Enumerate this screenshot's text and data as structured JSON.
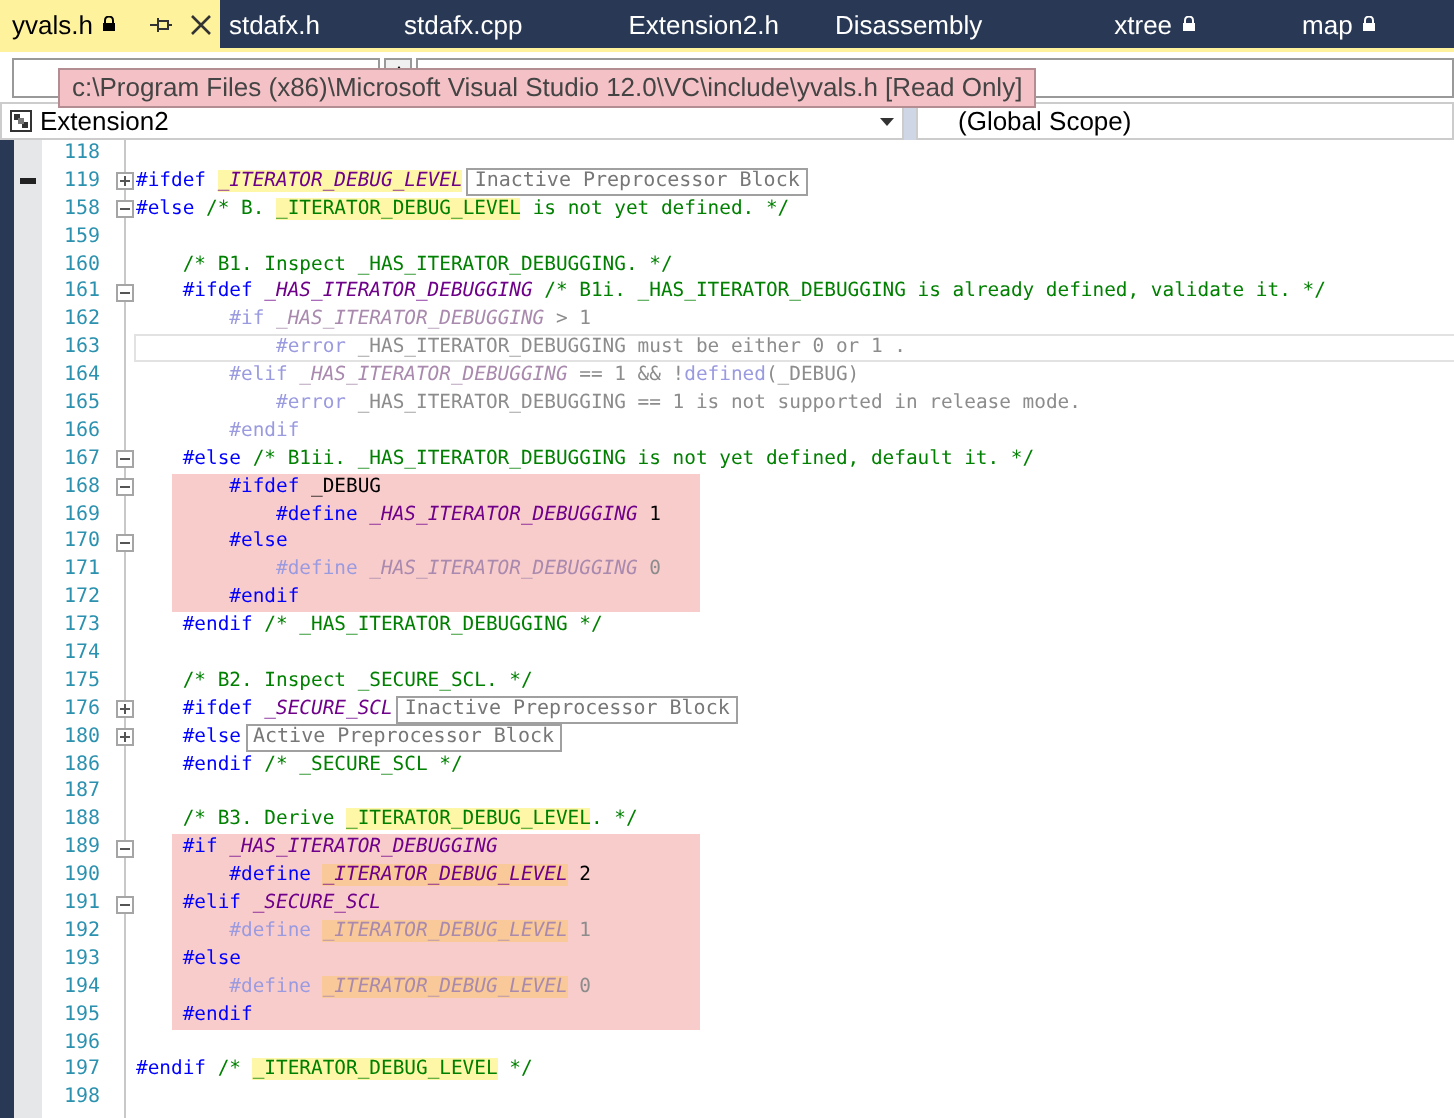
{
  "tabs": [
    {
      "label": "yvals.h",
      "selected": true,
      "locked": true,
      "pinnable": true
    },
    {
      "label": "stdafx.h",
      "selected": false,
      "locked": false,
      "pinnable": false
    },
    {
      "label": "stdafx.cpp",
      "selected": false,
      "locked": false,
      "pinnable": false
    },
    {
      "label": "Extension2.h",
      "selected": false,
      "locked": false,
      "pinnable": false
    },
    {
      "label": "Disassembly",
      "selected": false,
      "locked": false,
      "pinnable": false
    },
    {
      "label": "xtree",
      "selected": false,
      "locked": true,
      "pinnable": false
    },
    {
      "label": "map",
      "selected": false,
      "locked": true,
      "pinnable": false
    }
  ],
  "tooltip": "c:\\Program Files (x86)\\Microsoft Visual Studio 12.0\\VC\\include\\yvals.h [Read Only]",
  "navigation": {
    "project": "Extension2",
    "scope": "(Global Scope)"
  },
  "lines": [
    {
      "number": "118",
      "kind": "plain",
      "shaded": false,
      "current": false,
      "marked": false
    },
    {
      "number": "119",
      "kind": "collapsed-block",
      "shaded": false,
      "current": false,
      "marked": true,
      "tokens": [
        {
          "text": "#ifdef ",
          "kind": "directive",
          "highlight": false
        },
        {
          "text": "_ITERATOR_DEBUG_LEVEL",
          "kind": "macro",
          "highlight": true
        }
      ],
      "collapsed_label": "Inactive Preprocessor Block"
    },
    {
      "number": "158",
      "kind": "expanded-block",
      "shaded": false,
      "current": false,
      "marked": false,
      "tokens": [
        {
          "text": "#else ",
          "kind": "directive",
          "highlight": false
        },
        {
          "text": "/* B. ",
          "kind": "comment",
          "highlight": false
        },
        {
          "text": "_ITERATOR_DEBUG_LEVEL",
          "kind": "comment",
          "highlight": true
        },
        {
          "text": " is not yet defined. */",
          "kind": "comment",
          "highlight": false
        }
      ]
    },
    {
      "number": "159",
      "kind": "plain",
      "shaded": false,
      "current": false,
      "marked": false
    },
    {
      "number": "160",
      "kind": "plain",
      "shaded": false,
      "current": false,
      "marked": false,
      "tokens": [
        {
          "text": "    /* B1. Inspect _HAS_ITERATOR_DEBUGGING. */",
          "kind": "comment",
          "highlight": false
        }
      ]
    },
    {
      "number": "161",
      "kind": "expanded-block",
      "shaded": false,
      "current": false,
      "marked": false,
      "tokens": [
        {
          "text": "    #ifdef ",
          "kind": "directive",
          "highlight": false
        },
        {
          "text": "_HAS_ITERATOR_DEBUGGING",
          "kind": "macro",
          "highlight": false
        },
        {
          "text": " /* B1i. _HAS_ITERATOR_DEBUGGING is already defined, validate it. */",
          "kind": "comment",
          "highlight": false
        }
      ]
    },
    {
      "number": "162",
      "kind": "plain",
      "shaded": false,
      "current": false,
      "marked": false,
      "tokens": [
        {
          "text": "        #if ",
          "kind": "dim-directive",
          "highlight": false
        },
        {
          "text": "_HAS_ITERATOR_DEBUGGING",
          "kind": "dim-macro",
          "highlight": false
        },
        {
          "text": " > 1",
          "kind": "dim-text",
          "highlight": false
        }
      ]
    },
    {
      "number": "163",
      "kind": "plain",
      "shaded": false,
      "current": true,
      "marked": false,
      "tokens": [
        {
          "text": "            #error ",
          "kind": "dim-directive",
          "highlight": false
        },
        {
          "text": "_HAS_ITERATOR_DEBUGGING must be either 0 or 1 .",
          "kind": "dim-text",
          "highlight": false
        }
      ]
    },
    {
      "number": "164",
      "kind": "plain",
      "shaded": false,
      "current": false,
      "marked": false,
      "tokens": [
        {
          "text": "        #elif ",
          "kind": "dim-directive",
          "highlight": false
        },
        {
          "text": "_HAS_ITERATOR_DEBUGGING",
          "kind": "dim-macro",
          "highlight": false
        },
        {
          "text": " == 1 && !",
          "kind": "dim-text",
          "highlight": false
        },
        {
          "text": "defined",
          "kind": "dim-directive",
          "highlight": false
        },
        {
          "text": "(_DEBUG)",
          "kind": "dim-text",
          "highlight": false
        }
      ]
    },
    {
      "number": "165",
      "kind": "plain",
      "shaded": false,
      "current": false,
      "marked": false,
      "tokens": [
        {
          "text": "            #error ",
          "kind": "dim-directive",
          "highlight": false
        },
        {
          "text": "_HAS_ITERATOR_DEBUGGING == 1 is not supported in release mode.",
          "kind": "dim-text",
          "highlight": false
        }
      ]
    },
    {
      "number": "166",
      "kind": "plain",
      "shaded": false,
      "current": false,
      "marked": false,
      "tokens": [
        {
          "text": "        #endif",
          "kind": "dim-directive",
          "highlight": false
        }
      ]
    },
    {
      "number": "167",
      "kind": "expanded-block",
      "shaded": false,
      "current": false,
      "marked": false,
      "tokens": [
        {
          "text": "    #else ",
          "kind": "directive",
          "highlight": false
        },
        {
          "text": "/* B1ii. _HAS_ITERATOR_DEBUGGING is not yet defined, default it. */",
          "kind": "comment",
          "highlight": false
        }
      ]
    },
    {
      "number": "168",
      "kind": "expanded-block",
      "shaded": true,
      "current": false,
      "marked": false,
      "tokens": [
        {
          "text": "        #ifdef ",
          "kind": "directive",
          "highlight": false
        },
        {
          "text": "_DEBUG",
          "kind": "text",
          "highlight": false
        }
      ]
    },
    {
      "number": "169",
      "kind": "plain",
      "shaded": true,
      "current": false,
      "marked": false,
      "tokens": [
        {
          "text": "            #define ",
          "kind": "directive",
          "highlight": false
        },
        {
          "text": "_HAS_ITERATOR_DEBUGGING",
          "kind": "macro",
          "highlight": false
        },
        {
          "text": " 1",
          "kind": "text",
          "highlight": false
        }
      ]
    },
    {
      "number": "170",
      "kind": "expanded-block",
      "shaded": true,
      "current": false,
      "marked": false,
      "tokens": [
        {
          "text": "        #else",
          "kind": "directive",
          "highlight": false
        }
      ]
    },
    {
      "number": "171",
      "kind": "plain",
      "shaded": true,
      "current": false,
      "marked": false,
      "tokens": [
        {
          "text": "            #define ",
          "kind": "dim-directive",
          "highlight": false
        },
        {
          "text": "_HAS_ITERATOR_DEBUGGING",
          "kind": "dim-macro",
          "highlight": false
        },
        {
          "text": " 0",
          "kind": "dim-text",
          "highlight": false
        }
      ]
    },
    {
      "number": "172",
      "kind": "plain",
      "shaded": true,
      "current": false,
      "marked": false,
      "tokens": [
        {
          "text": "        #endif",
          "kind": "directive",
          "highlight": false
        }
      ]
    },
    {
      "number": "173",
      "kind": "plain",
      "shaded": false,
      "current": false,
      "marked": false,
      "tokens": [
        {
          "text": "    #endif ",
          "kind": "directive",
          "highlight": false
        },
        {
          "text": "/* _HAS_ITERATOR_DEBUGGING */",
          "kind": "comment",
          "highlight": false
        }
      ]
    },
    {
      "number": "174",
      "kind": "plain",
      "shaded": false,
      "current": false,
      "marked": false
    },
    {
      "number": "175",
      "kind": "plain",
      "shaded": false,
      "current": false,
      "marked": false,
      "tokens": [
        {
          "text": "    /* B2. Inspect _SECURE_SCL. */",
          "kind": "comment",
          "highlight": false
        }
      ]
    },
    {
      "number": "176",
      "kind": "collapsed-block",
      "shaded": false,
      "current": false,
      "marked": false,
      "tokens": [
        {
          "text": "    #ifdef ",
          "kind": "directive",
          "highlight": false
        },
        {
          "text": "_SECURE_SCL",
          "kind": "macro",
          "highlight": false
        }
      ],
      "collapsed_label": "Inactive Preprocessor Block"
    },
    {
      "number": "180",
      "kind": "collapsed-block",
      "shaded": false,
      "current": false,
      "marked": false,
      "tokens": [
        {
          "text": "    #else",
          "kind": "directive",
          "highlight": false
        }
      ],
      "collapsed_label": "Active Preprocessor Block"
    },
    {
      "number": "186",
      "kind": "plain",
      "shaded": false,
      "current": false,
      "marked": false,
      "tokens": [
        {
          "text": "    #endif ",
          "kind": "directive",
          "highlight": false
        },
        {
          "text": "/* _SECURE_SCL */",
          "kind": "comment",
          "highlight": false
        }
      ]
    },
    {
      "number": "187",
      "kind": "plain",
      "shaded": false,
      "current": false,
      "marked": false
    },
    {
      "number": "188",
      "kind": "plain",
      "shaded": false,
      "current": false,
      "marked": false,
      "tokens": [
        {
          "text": "    /* B3. Derive ",
          "kind": "comment",
          "highlight": false
        },
        {
          "text": "_ITERATOR_DEBUG_LEVEL",
          "kind": "comment",
          "highlight": true
        },
        {
          "text": ". */",
          "kind": "comment",
          "highlight": false
        }
      ]
    },
    {
      "number": "189",
      "kind": "expanded-block",
      "shaded": true,
      "current": false,
      "marked": false,
      "tokens": [
        {
          "text": "    #if ",
          "kind": "directive",
          "highlight": false
        },
        {
          "text": "_HAS_ITERATOR_DEBUGGING",
          "kind": "macro",
          "highlight": false
        }
      ]
    },
    {
      "number": "190",
      "kind": "plain",
      "shaded": true,
      "current": false,
      "marked": false,
      "tokens": [
        {
          "text": "        #define ",
          "kind": "directive",
          "highlight": false
        },
        {
          "text": "_ITERATOR_DEBUG_LEVEL",
          "kind": "macro",
          "highlight": true
        },
        {
          "text": " 2",
          "kind": "text",
          "highlight": false
        }
      ]
    },
    {
      "number": "191",
      "kind": "expanded-block",
      "shaded": true,
      "current": false,
      "marked": false,
      "tokens": [
        {
          "text": "    #elif ",
          "kind": "directive",
          "highlight": false
        },
        {
          "text": "_SECURE_SCL",
          "kind": "macro",
          "highlight": false
        }
      ]
    },
    {
      "number": "192",
      "kind": "plain",
      "shaded": true,
      "current": false,
      "marked": false,
      "tokens": [
        {
          "text": "        #define ",
          "kind": "dim-directive",
          "highlight": false
        },
        {
          "text": "_ITERATOR_DEBUG_LEVEL",
          "kind": "dim-macro",
          "highlight": true
        },
        {
          "text": " 1",
          "kind": "dim-text",
          "highlight": false
        }
      ]
    },
    {
      "number": "193",
      "kind": "plain",
      "shaded": true,
      "current": false,
      "marked": false,
      "tokens": [
        {
          "text": "    #else",
          "kind": "directive",
          "highlight": false
        }
      ]
    },
    {
      "number": "194",
      "kind": "plain",
      "shaded": true,
      "current": false,
      "marked": false,
      "tokens": [
        {
          "text": "        #define ",
          "kind": "dim-directive",
          "highlight": false
        },
        {
          "text": "_ITERATOR_DEBUG_LEVEL",
          "kind": "dim-macro",
          "highlight": true
        },
        {
          "text": " 0",
          "kind": "dim-text",
          "highlight": false
        }
      ]
    },
    {
      "number": "195",
      "kind": "plain",
      "shaded": true,
      "current": false,
      "marked": false,
      "tokens": [
        {
          "text": "    #endif",
          "kind": "directive",
          "highlight": false
        }
      ]
    },
    {
      "number": "196",
      "kind": "plain",
      "shaded": false,
      "current": false,
      "marked": false
    },
    {
      "number": "197",
      "kind": "plain",
      "shaded": false,
      "current": false,
      "marked": false,
      "tokens": [
        {
          "text": "#endif ",
          "kind": "directive",
          "highlight": false
        },
        {
          "text": "/* ",
          "kind": "comment",
          "highlight": false
        },
        {
          "text": "_ITERATOR_DEBUG_LEVEL",
          "kind": "comment",
          "highlight": true
        },
        {
          "text": " */",
          "kind": "comment",
          "highlight": false
        }
      ]
    },
    {
      "number": "198",
      "kind": "plain",
      "shaded": false,
      "current": false,
      "marked": false
    }
  ]
}
